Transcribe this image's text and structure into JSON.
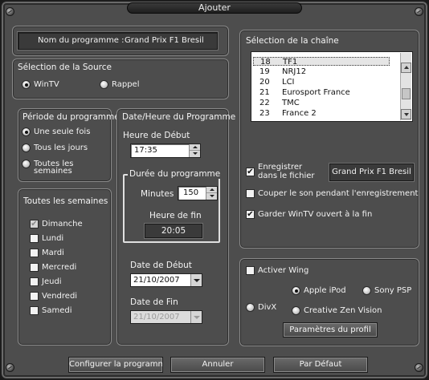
{
  "window": {
    "title": "Ajouter"
  },
  "program": {
    "label": "Nom du programme :",
    "value": "Grand Prix F1 Bresil"
  },
  "source": {
    "title": "Sélection de la Source",
    "options": [
      {
        "label": "WinTV",
        "selected": true
      },
      {
        "label": "Rappel",
        "selected": false
      }
    ]
  },
  "period": {
    "title": "Période du programme",
    "options": [
      {
        "label": "Une seule fois",
        "selected": true
      },
      {
        "label": "Tous les jours",
        "selected": false
      },
      {
        "label": "Toutes les",
        "label2": "semaines",
        "selected": false
      }
    ]
  },
  "weekly": {
    "title": "Toutes les semaines",
    "days": [
      {
        "label": "Dimanche",
        "checked": true
      },
      {
        "label": "Lundi",
        "checked": false
      },
      {
        "label": "Mardi",
        "checked": false
      },
      {
        "label": "Mercredi",
        "checked": false
      },
      {
        "label": "Jeudi",
        "checked": false
      },
      {
        "label": "Vendredi",
        "checked": false
      },
      {
        "label": "Samedi",
        "checked": false
      }
    ]
  },
  "datetime": {
    "title": "Date/Heure du Programme",
    "start_label": "Heure de Début",
    "start_value": "17:35",
    "duration_title": "Durée du programme",
    "minutes_label": "Minutes",
    "minutes_value": "150",
    "end_label": "Heure de fin",
    "end_value": "20:05",
    "start_date_label": "Date de Début",
    "start_date_value": "21/10/2007",
    "end_date_label": "Date de Fin",
    "end_date_value": "21/10/2007"
  },
  "channel": {
    "title": "Sélection de la chaîne",
    "items": [
      {
        "num": "18",
        "name": "TF1",
        "selected": true
      },
      {
        "num": "19",
        "name": "NRJ12",
        "selected": false
      },
      {
        "num": "20",
        "name": "LCI",
        "selected": false
      },
      {
        "num": "21",
        "name": "Eurosport France",
        "selected": false
      },
      {
        "num": "22",
        "name": "TMC",
        "selected": false
      },
      {
        "num": "23",
        "name": "France 2",
        "selected": false
      }
    ],
    "record_label_1": "Enregistrer",
    "record_label_2": "dans le fichier",
    "record_checked": true,
    "file_value": "Grand Prix F1 Bresil",
    "mute_label": "Couper le son pendant l'enregistrement",
    "mute_checked": false,
    "keep_open_label": "Garder WinTV ouvert à la fin",
    "keep_open_checked": true
  },
  "wing": {
    "enable_label": "Activer Wing",
    "enable_checked": false,
    "divx_label": "DivX",
    "ipod_label": "Apple iPod",
    "psp_label": "Sony PSP",
    "zen_label": "Creative Zen Vision",
    "profile_button": "Paramètres du profil"
  },
  "footer": {
    "configure": "Configurer la programmation",
    "cancel": "Annuler",
    "default": "Par Défaut"
  }
}
